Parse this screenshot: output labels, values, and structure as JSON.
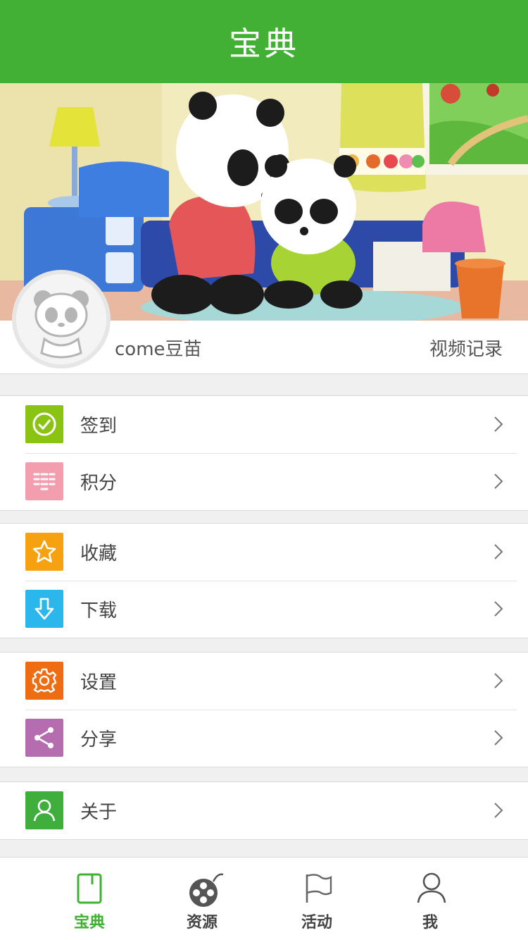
{
  "header": {
    "title": "宝典"
  },
  "profile": {
    "name": "come豆苗",
    "video_record": "视频记录"
  },
  "menu_groups": [
    [
      {
        "label": "签到",
        "icon": "check-circle-icon",
        "color": "#8ac314"
      },
      {
        "label": "积分",
        "icon": "points-icon",
        "color": "#f39eaf"
      }
    ],
    [
      {
        "label": "收藏",
        "icon": "star-icon",
        "color": "#f6a10f"
      },
      {
        "label": "下载",
        "icon": "download-icon",
        "color": "#2cb7ec"
      }
    ],
    [
      {
        "label": "设置",
        "icon": "gear-icon",
        "color": "#ee6d13"
      },
      {
        "label": "分享",
        "icon": "share-icon",
        "color": "#b56db0"
      }
    ],
    [
      {
        "label": "关于",
        "icon": "person-icon",
        "color": "#3fae3c"
      }
    ]
  ],
  "tabs": [
    {
      "label": "宝典",
      "icon": "book-icon",
      "active": true
    },
    {
      "label": "资源",
      "icon": "film-reel-icon",
      "active": false
    },
    {
      "label": "活动",
      "icon": "flag-icon",
      "active": false
    },
    {
      "label": "我",
      "icon": "user-icon",
      "active": false
    }
  ],
  "colors": {
    "brand_green": "#42b035",
    "text": "#444444",
    "background": "#f0f0f0"
  }
}
